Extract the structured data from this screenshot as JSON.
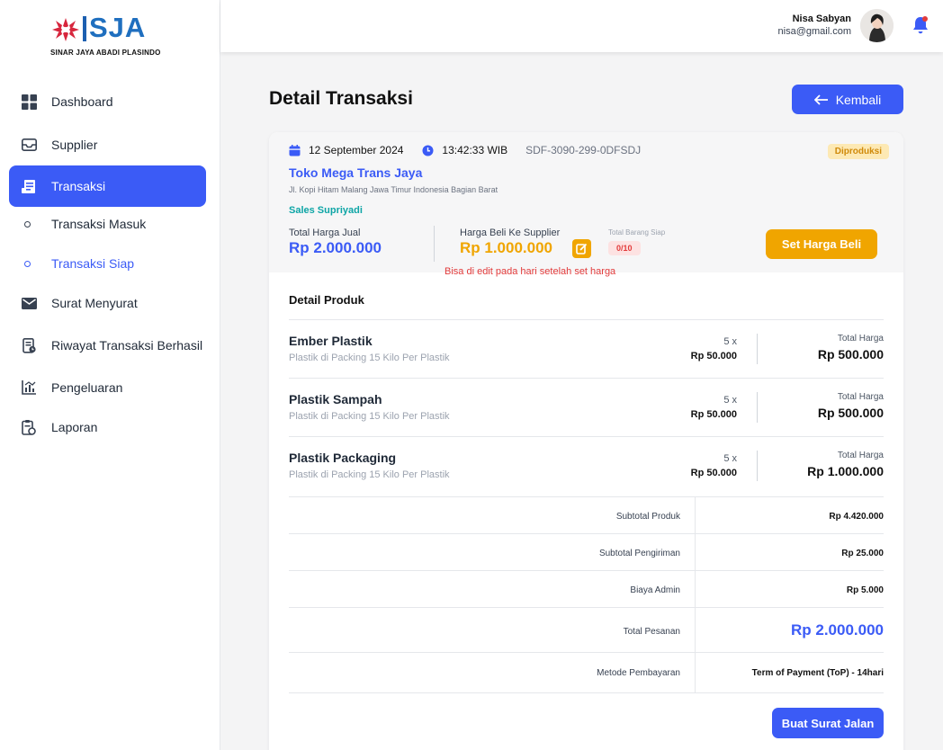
{
  "brand": {
    "name": "SJA",
    "tagline": "SINAR JAYA ABADI PLASINDO",
    "colors": {
      "red": "#d7263d",
      "blue": "#1f6fbf"
    }
  },
  "sidebar": {
    "items": [
      {
        "label": "Dashboard",
        "icon": "grid-icon"
      },
      {
        "label": "Supplier",
        "icon": "inbox-icon"
      },
      {
        "label": "Transaksi",
        "icon": "receipt-icon",
        "active": true
      },
      {
        "label": "Transaksi Masuk",
        "sub": true
      },
      {
        "label": "Transaksi Siap",
        "sub": true,
        "active": true
      },
      {
        "label": "Surat Menyurat",
        "icon": "mail-icon"
      },
      {
        "label": "Riwayat Transaksi Berhasil",
        "icon": "history-icon"
      },
      {
        "label": "Pengeluaran",
        "icon": "chart-icon"
      },
      {
        "label": "Laporan",
        "icon": "report-icon"
      }
    ]
  },
  "user": {
    "name": "Nisa Sabyan",
    "email": "nisa@gmail.com"
  },
  "header": {
    "title": "Detail Transaksi",
    "back_label": "Kembali"
  },
  "transaction": {
    "date": "12 September 2024",
    "time": "13:42:33 WIB",
    "code": "SDF-3090-299-0DFSDJ",
    "status": "Diproduksi",
    "store": "Toko Mega Trans Jaya",
    "address": "Jl. Kopi Hitam Malang Jawa Timur Indonesia Bagian Barat",
    "sales": "Sales Supriyadi",
    "sell_label": "Total Harga Jual",
    "sell_value": "Rp 2.000.000",
    "buy_label": "Harga Beli Ke Supplier",
    "buy_value": "Rp 1.000.000",
    "ready_label": "Total Barang Siap",
    "ready_value": "0/10",
    "set_price_label": "Set Harga Beli",
    "edit_note": "Bisa di edit pada hari setelah set harga"
  },
  "products": {
    "title": "Detail Produk",
    "total_label": "Total Harga",
    "items": [
      {
        "name": "Ember Plastik",
        "desc": "Plastik di Packing 15 Kilo Per Plastik",
        "qty": "5 x",
        "unit_price": "Rp 50.000",
        "total": "Rp 500.000"
      },
      {
        "name": "Plastik Sampah",
        "desc": "Plastik di Packing 15 Kilo Per Plastik",
        "qty": "5 x",
        "unit_price": "Rp 50.000",
        "total": "Rp 500.000"
      },
      {
        "name": "Plastik Packaging",
        "desc": "Plastik di Packing 15 Kilo Per Plastik",
        "qty": "5 x",
        "unit_price": "Rp 50.000",
        "total": "Rp 1.000.000"
      }
    ]
  },
  "summary": [
    {
      "label": "Subtotal Produk",
      "value": "Rp 4.420.000"
    },
    {
      "label": "Subtotal Pengiriman",
      "value": "Rp 25.000"
    },
    {
      "label": "Biaya Admin",
      "value": "Rp 5.000"
    },
    {
      "label": "Total Pesanan",
      "value": "Rp 2.000.000"
    },
    {
      "label": "Metode Pembayaran",
      "value": "Term of Payment (ToP) - 14hari"
    }
  ],
  "footer": {
    "action_label": "Buat Surat Jalan"
  }
}
